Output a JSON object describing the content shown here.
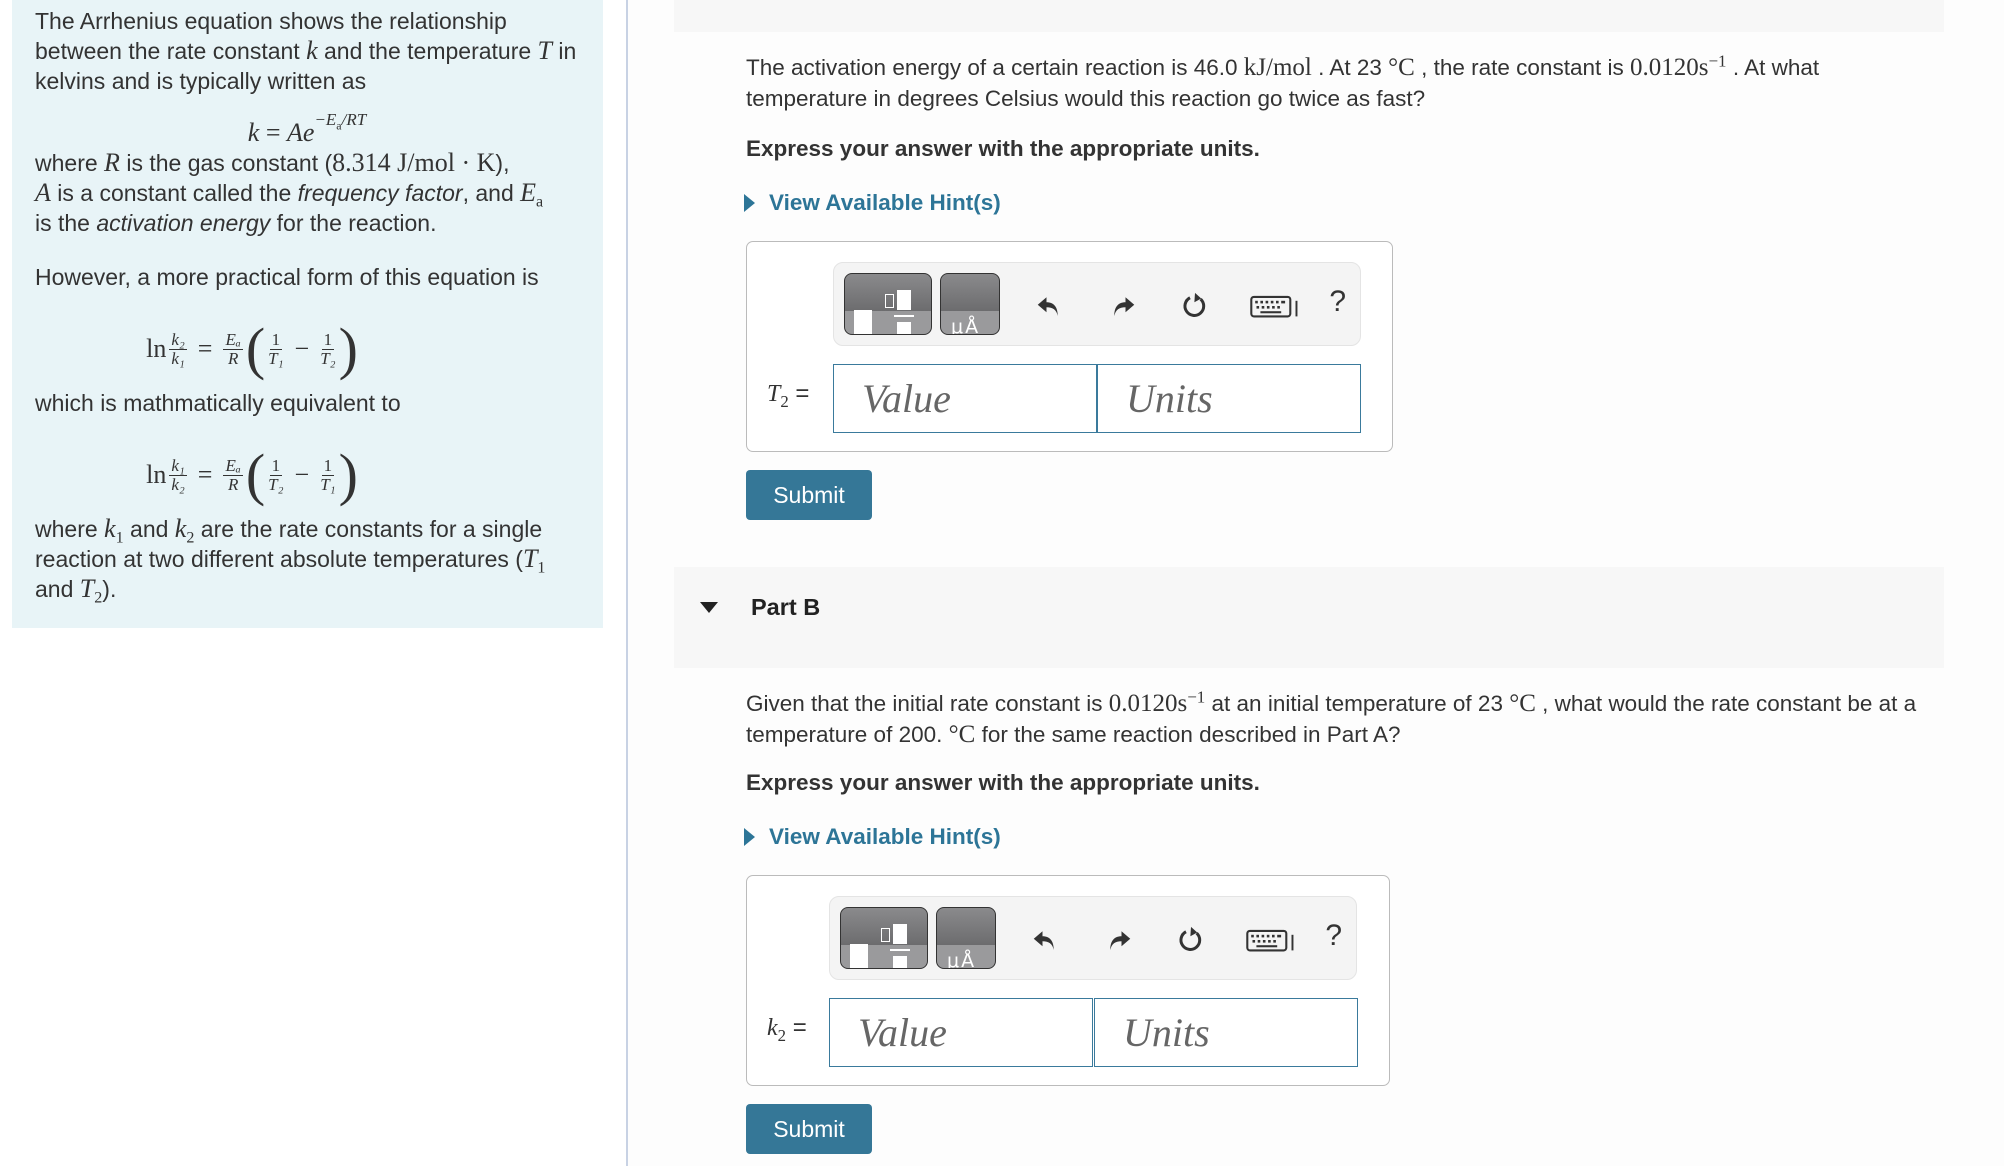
{
  "intro": {
    "p1_a": "The Arrhenius equation shows the relationship between the rate constant ",
    "p1_k": "k",
    "p1_b": " and the temperature ",
    "p1_T": "T",
    "p1_c": " in kelvins and is typically written as",
    "eq1_lhs": "k",
    "eq1_eq": " = ",
    "eq1_rhs": "Ae",
    "eq1_exp": "−E",
    "eq1_exp_sub": "a",
    "eq1_exp_tail": "/RT",
    "p2_a": "where ",
    "p2_R": "R",
    "p2_b": " is the gas constant (",
    "p2_const": "8.314 J/mol · K",
    "p2_c": "),",
    "p2_A": "A",
    "p2_d": " is a constant called the ",
    "p2_freq": "frequency factor",
    "p2_e": ", and ",
    "p2_Ea": "E",
    "p2_Ea_sub": "a",
    "p2_f": " is the ",
    "p2_act": "activation energy",
    "p2_g": " for the reaction.",
    "p3": "However, a more practical form of this equation is",
    "eq2": {
      "ln": "ln",
      "num1": "k₂",
      "den1": "k₁",
      "eq": "=",
      "num2": "Eₐ",
      "den2": "R",
      "f1n": "1",
      "f1d": "T₁",
      "minus": "−",
      "f2n": "1",
      "f2d": "T₂"
    },
    "p4": "which is mathmatically equivalent to",
    "eq3": {
      "ln": "ln",
      "num1": "k₁",
      "den1": "k₂",
      "eq": "=",
      "num2": "Eₐ",
      "den2": "R",
      "f1n": "1",
      "f1d": "T₂",
      "minus": "−",
      "f2n": "1",
      "f2d": "T₁"
    },
    "p5_a": "where ",
    "p5_k1": "k",
    "p5_k1_sub": "1",
    "p5_b": " and ",
    "p5_k2": "k",
    "p5_k2_sub": "2",
    "p5_c": " are the rate constants for a single reaction at two different absolute temperatures (",
    "p5_T1": "T",
    "p5_T1_sub": "1",
    "p5_d": " and ",
    "p5_T2": "T",
    "p5_T2_sub": "2",
    "p5_e": ")."
  },
  "partA": {
    "q_a": "The activation energy of a certain reaction is 46.0 ",
    "q_unit1": "kJ/mol",
    "q_b": " . At 23 ",
    "q_deg": "°C",
    "q_c": " , the rate constant is ",
    "q_k": "0.0120s",
    "q_k_exp": "−1",
    "q_d": " . At what temperature in degrees Celsius would this reaction go twice as fast?",
    "instruction": "Express your answer with the appropriate units.",
    "hint_label": "View Available Hint(s)",
    "answer_label_var": "T",
    "answer_label_sub": "2",
    "answer_label_eq": " =",
    "value_placeholder": "Value",
    "units_placeholder": "Units",
    "submit_label": "Submit"
  },
  "partB": {
    "title": "Part B",
    "q_a": "Given that the initial rate constant is ",
    "q_k": "0.0120s",
    "q_k_exp": "−1",
    "q_b": " at an initial temperature of 23 ",
    "q_deg": "°C",
    "q_c": " , what would the rate constant be at a temperature of 200. ",
    "q_deg2": "°C",
    "q_d": " for the same reaction described in Part A?",
    "instruction": "Express your answer with the appropriate units.",
    "hint_label": "View Available Hint(s)",
    "answer_label_var": "k",
    "answer_label_sub": "2",
    "answer_label_eq": " =",
    "value_placeholder": "Value",
    "units_placeholder": "Units",
    "submit_label": "Submit"
  },
  "toolbar": {
    "templates_icon": "fraction-template-icon",
    "units_icon": "units-icon",
    "unit_glyph": "μÅ",
    "undo_icon": "undo-icon",
    "redo_icon": "redo-icon",
    "reset_icon": "reset-icon",
    "keyboard_icon": "keyboard-icon",
    "help_label": "?"
  },
  "colors": {
    "intro_bg": "#e8f4f7",
    "accent": "#357797",
    "link": "#2d7597",
    "input_border": "#3a7a9c"
  }
}
